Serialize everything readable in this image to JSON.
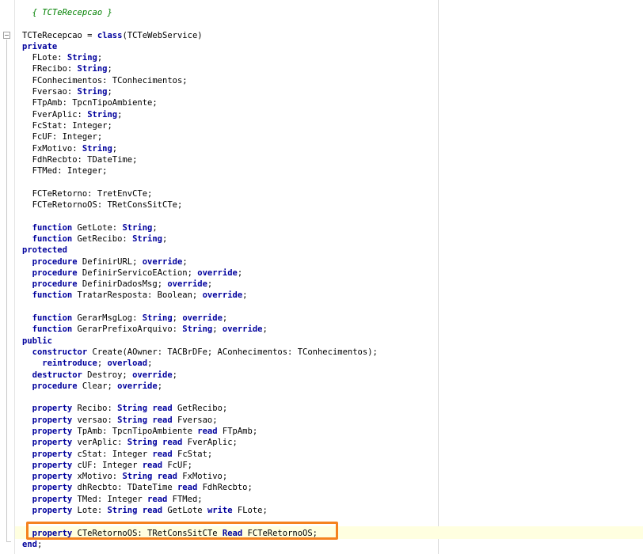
{
  "colors": {
    "keyword": "#00009c",
    "comment": "#008000",
    "text": "#000000",
    "highlight_border": "#f5821f",
    "current_line": "#ffffe0"
  },
  "code_lines": [
    [
      [
        "cm",
        "  { TCTeRecepcao }"
      ]
    ],
    [],
    [
      [
        "tx",
        "TCTeRecepcao = "
      ],
      [
        "kw",
        "class"
      ],
      [
        "tx",
        "(TCTeWebService)"
      ]
    ],
    [
      [
        "kw",
        "private"
      ]
    ],
    [
      [
        "tx",
        "  FLote: "
      ],
      [
        "kw",
        "String"
      ],
      [
        "tx",
        ";"
      ]
    ],
    [
      [
        "tx",
        "  FRecibo: "
      ],
      [
        "kw",
        "String"
      ],
      [
        "tx",
        ";"
      ]
    ],
    [
      [
        "tx",
        "  FConhecimentos: TConhecimentos;"
      ]
    ],
    [
      [
        "tx",
        "  Fversao: "
      ],
      [
        "kw",
        "String"
      ],
      [
        "tx",
        ";"
      ]
    ],
    [
      [
        "tx",
        "  FTpAmb: TpcnTipoAmbiente;"
      ]
    ],
    [
      [
        "tx",
        "  FverAplic: "
      ],
      [
        "kw",
        "String"
      ],
      [
        "tx",
        ";"
      ]
    ],
    [
      [
        "tx",
        "  FcStat: Integer;"
      ]
    ],
    [
      [
        "tx",
        "  FcUF: Integer;"
      ]
    ],
    [
      [
        "tx",
        "  FxMotivo: "
      ],
      [
        "kw",
        "String"
      ],
      [
        "tx",
        ";"
      ]
    ],
    [
      [
        "tx",
        "  FdhRecbto: TDateTime;"
      ]
    ],
    [
      [
        "tx",
        "  FTMed: Integer;"
      ]
    ],
    [],
    [
      [
        "tx",
        "  FCTeRetorno: TretEnvCTe;"
      ]
    ],
    [
      [
        "tx",
        "  FCTeRetornoOS: TRetConsSitCTe;"
      ]
    ],
    [],
    [
      [
        "kw",
        "  function"
      ],
      [
        "tx",
        " GetLote: "
      ],
      [
        "kw",
        "String"
      ],
      [
        "tx",
        ";"
      ]
    ],
    [
      [
        "kw",
        "  function"
      ],
      [
        "tx",
        " GetRecibo: "
      ],
      [
        "kw",
        "String"
      ],
      [
        "tx",
        ";"
      ]
    ],
    [
      [
        "kw",
        "protected"
      ]
    ],
    [
      [
        "kw",
        "  procedure"
      ],
      [
        "tx",
        " DefinirURL; "
      ],
      [
        "kw",
        "override"
      ],
      [
        "tx",
        ";"
      ]
    ],
    [
      [
        "kw",
        "  procedure"
      ],
      [
        "tx",
        " DefinirServicoEAction; "
      ],
      [
        "kw",
        "override"
      ],
      [
        "tx",
        ";"
      ]
    ],
    [
      [
        "kw",
        "  procedure"
      ],
      [
        "tx",
        " DefinirDadosMsg; "
      ],
      [
        "kw",
        "override"
      ],
      [
        "tx",
        ";"
      ]
    ],
    [
      [
        "kw",
        "  function"
      ],
      [
        "tx",
        " TratarResposta: Boolean; "
      ],
      [
        "kw",
        "override"
      ],
      [
        "tx",
        ";"
      ]
    ],
    [],
    [
      [
        "kw",
        "  function"
      ],
      [
        "tx",
        " GerarMsgLog: "
      ],
      [
        "kw",
        "String"
      ],
      [
        "tx",
        "; "
      ],
      [
        "kw",
        "override"
      ],
      [
        "tx",
        ";"
      ]
    ],
    [
      [
        "kw",
        "  function"
      ],
      [
        "tx",
        " GerarPrefixoArquivo: "
      ],
      [
        "kw",
        "String"
      ],
      [
        "tx",
        "; "
      ],
      [
        "kw",
        "override"
      ],
      [
        "tx",
        ";"
      ]
    ],
    [
      [
        "kw",
        "public"
      ]
    ],
    [
      [
        "kw",
        "  constructor"
      ],
      [
        "tx",
        " Create(AOwner: TACBrDFe; AConhecimentos: TConhecimentos);"
      ]
    ],
    [
      [
        "kw",
        "    reintroduce"
      ],
      [
        "tx",
        "; "
      ],
      [
        "kw",
        "overload"
      ],
      [
        "tx",
        ";"
      ]
    ],
    [
      [
        "kw",
        "  destructor"
      ],
      [
        "tx",
        " Destroy; "
      ],
      [
        "kw",
        "override"
      ],
      [
        "tx",
        ";"
      ]
    ],
    [
      [
        "kw",
        "  procedure"
      ],
      [
        "tx",
        " Clear; "
      ],
      [
        "kw",
        "override"
      ],
      [
        "tx",
        ";"
      ]
    ],
    [],
    [
      [
        "kw",
        "  property"
      ],
      [
        "tx",
        " Recibo: "
      ],
      [
        "kw",
        "String"
      ],
      [
        "kw",
        " read"
      ],
      [
        "tx",
        " GetRecibo;"
      ]
    ],
    [
      [
        "kw",
        "  property"
      ],
      [
        "tx",
        " versao: "
      ],
      [
        "kw",
        "String"
      ],
      [
        "kw",
        " read"
      ],
      [
        "tx",
        " Fversao;"
      ]
    ],
    [
      [
        "kw",
        "  property"
      ],
      [
        "tx",
        " TpAmb: TpcnTipoAmbiente "
      ],
      [
        "kw",
        "read"
      ],
      [
        "tx",
        " FTpAmb;"
      ]
    ],
    [
      [
        "kw",
        "  property"
      ],
      [
        "tx",
        " verAplic: "
      ],
      [
        "kw",
        "String"
      ],
      [
        "kw",
        " read"
      ],
      [
        "tx",
        " FverAplic;"
      ]
    ],
    [
      [
        "kw",
        "  property"
      ],
      [
        "tx",
        " cStat: Integer "
      ],
      [
        "kw",
        "read"
      ],
      [
        "tx",
        " FcStat;"
      ]
    ],
    [
      [
        "kw",
        "  property"
      ],
      [
        "tx",
        " cUF: Integer "
      ],
      [
        "kw",
        "read"
      ],
      [
        "tx",
        " FcUF;"
      ]
    ],
    [
      [
        "kw",
        "  property"
      ],
      [
        "tx",
        " xMotivo: "
      ],
      [
        "kw",
        "String"
      ],
      [
        "kw",
        " read"
      ],
      [
        "tx",
        " FxMotivo;"
      ]
    ],
    [
      [
        "kw",
        "  property"
      ],
      [
        "tx",
        " dhRecbto: TDateTime "
      ],
      [
        "kw",
        "read"
      ],
      [
        "tx",
        " FdhRecbto;"
      ]
    ],
    [
      [
        "kw",
        "  property"
      ],
      [
        "tx",
        " TMed: Integer "
      ],
      [
        "kw",
        "read"
      ],
      [
        "tx",
        " FTMed;"
      ]
    ],
    [
      [
        "kw",
        "  property"
      ],
      [
        "tx",
        " Lote: "
      ],
      [
        "kw",
        "String"
      ],
      [
        "kw",
        " read"
      ],
      [
        "tx",
        " GetLote "
      ],
      [
        "kw",
        "write"
      ],
      [
        "tx",
        " FLote;"
      ]
    ],
    [],
    [
      [
        "kw",
        "  property"
      ],
      [
        "tx",
        " CTeRetornoOS: TRetConsSitCTe "
      ],
      [
        "kw",
        "Read"
      ],
      [
        "tx",
        " FCTeRetornoOS;"
      ]
    ],
    [
      [
        "kw",
        "end"
      ],
      [
        "tx",
        ";"
      ]
    ]
  ],
  "highlighted_line_index": 46
}
